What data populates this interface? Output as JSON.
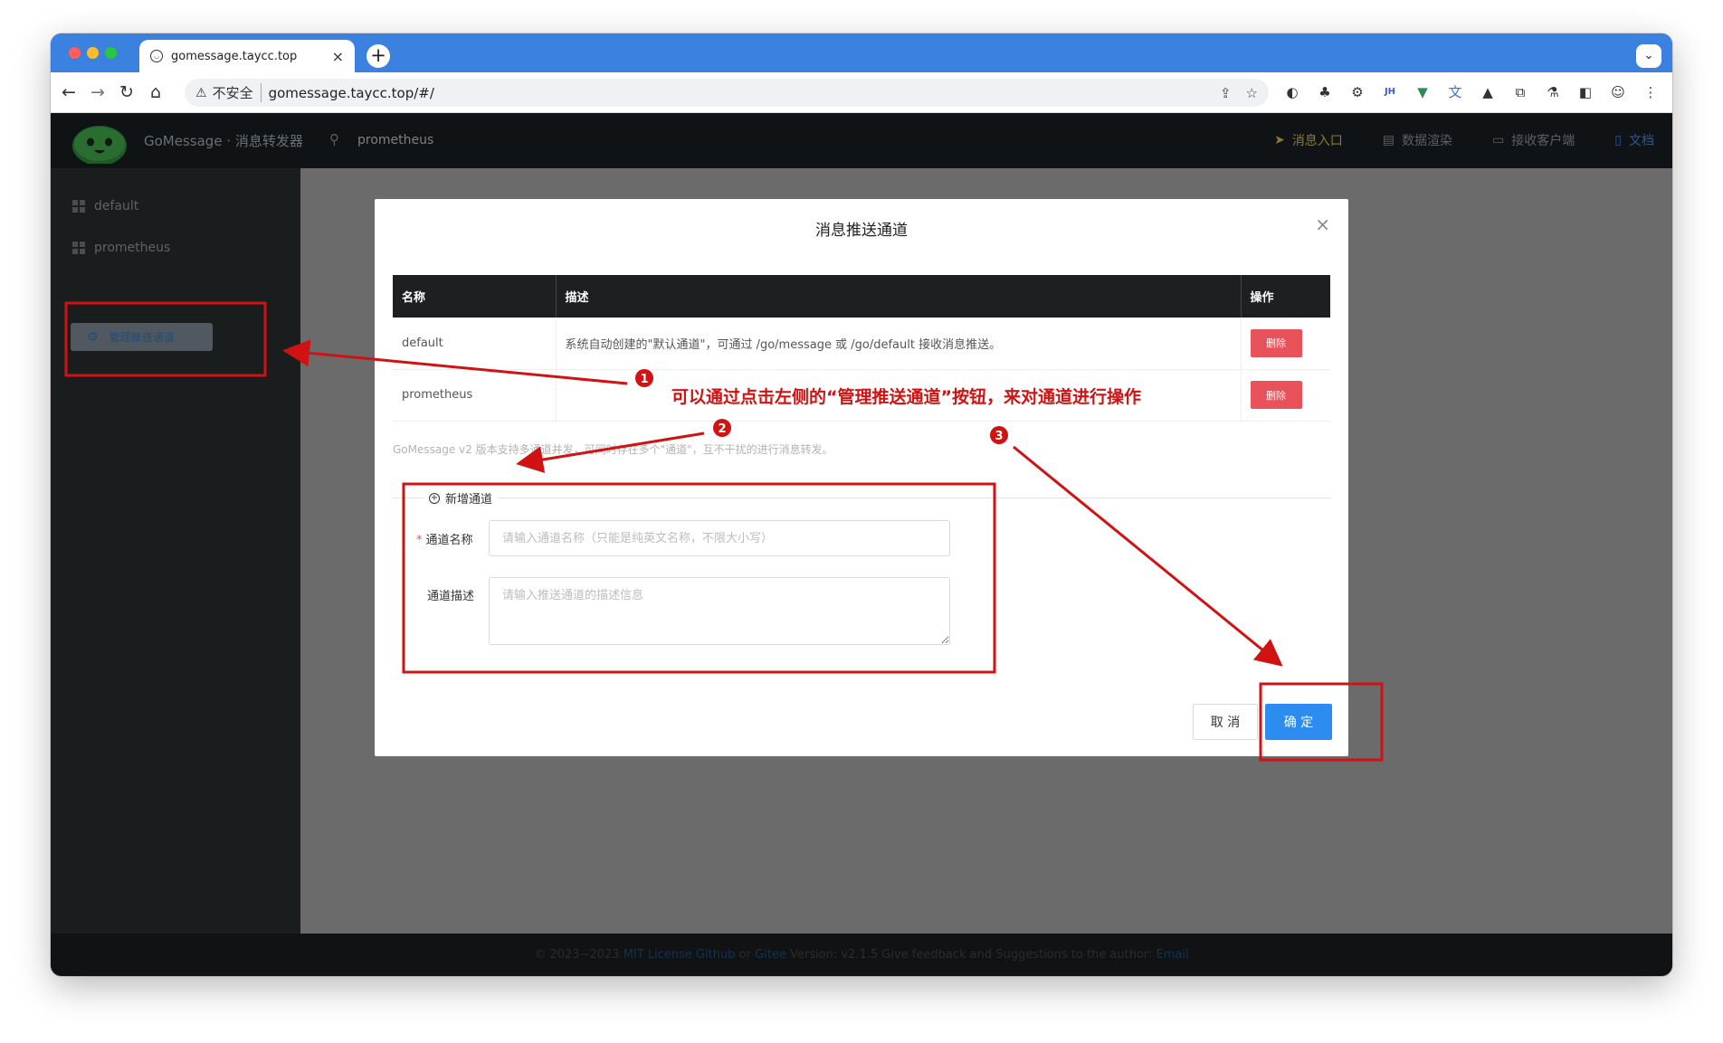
{
  "browser": {
    "tab_title": "gomessage.taycc.top",
    "tab_close": "×",
    "new_tab": "+",
    "tab_search": "⌄",
    "insecure_label": "不安全",
    "url": "gomessage.taycc.top/#/"
  },
  "app": {
    "title": "GoMessage · 消息转发器",
    "current_namespace": "prometheus",
    "nav": [
      {
        "label": "消息入口",
        "icon": "send-icon"
      },
      {
        "label": "数据渲染",
        "icon": "render-icon"
      },
      {
        "label": "接收客户端",
        "icon": "chat-icon"
      },
      {
        "label": "文档",
        "icon": "document-icon"
      }
    ],
    "sidebar": {
      "items": [
        {
          "label": "default"
        },
        {
          "label": "prometheus"
        }
      ],
      "manage_button": "管理推送通道"
    },
    "footer": {
      "copyright": "© 2023~2023",
      "license": "MIT License",
      "github": "Github",
      "or": "or",
      "gitee": "Gitee",
      "version": "Version: v2.1.5",
      "feedback": "Give feedback and Suggestions to the author:",
      "email": "Email"
    }
  },
  "modal": {
    "title": "消息推送通道",
    "close": "×",
    "table": {
      "headers": [
        "名称",
        "描述",
        "操作"
      ],
      "rows": [
        {
          "name": "default",
          "desc": "系统自动创建的\"默认通道\"，可通过 /go/message 或 /go/default 接收消息推送。",
          "action": "删除"
        },
        {
          "name": "prometheus",
          "desc": "",
          "action": "删除"
        }
      ]
    },
    "note": "GoMessage v2 版本支持多通道并发，可同时存在多个\"通道\"，互不干扰的进行消息转发。",
    "add_section": "新增通道",
    "name_label": "通道名称",
    "name_placeholder": "请输入通道名称（只能是纯英文名称，不限大小写）",
    "desc_label": "通道描述",
    "desc_placeholder": "请输入推送通道的描述信息",
    "cancel": "取 消",
    "ok": "确 定"
  },
  "annotation": {
    "text": "可以通过点击左侧的“管理推送通道”按钮，来对通道进行操作",
    "marker1": "1",
    "marker2": "2",
    "marker3": "3",
    "color": "#d11212"
  }
}
